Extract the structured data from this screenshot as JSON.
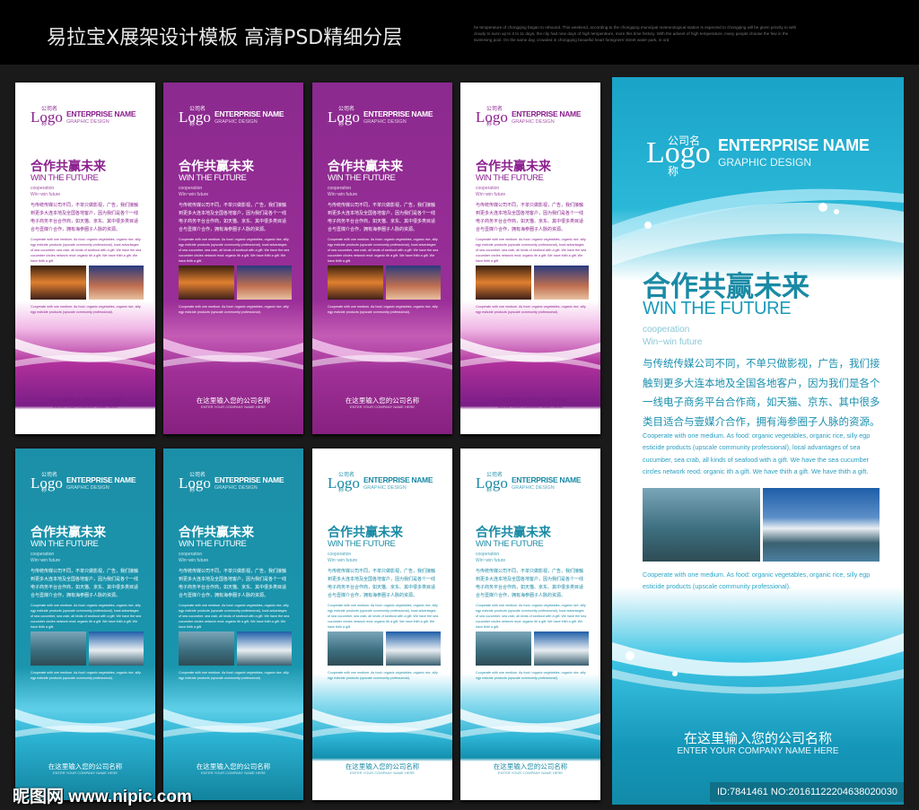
{
  "header": {
    "title": "易拉宝X展架设计模板 高清PSD精细分层",
    "note": "he temperature of chongqing began to rebound. This weekend, according to the chongqing municipal meteorological station is expected to chongqing will be given priority to with cloudy to sunn up to 3 to 11 days, the city had nine days of high temperature, more this time history. With the advent of high temperature, many people choose the few in the swimming pool. On the same day, crowded in chongqing beautiful heart foreigners' street water park, in ord"
  },
  "panel_text": {
    "logo_cn": "公司名称",
    "logo": "Logo",
    "enterprise": "ENTERPRISE NAME",
    "graphic": "GRAPHIC DESIGN",
    "headline": "合作共赢未来",
    "headline_en": "WIN THE FUTURE",
    "coop1": "cooperation",
    "coop2": "Win~win future",
    "body": "与传统传媒公司不同，不单只做影视，广告，我们接触到更多大连本地及全国各地客户，因为我们是各个一线电子商务平台合作商，如天猫、京东、其中很多类目适合与壹媒介合作，拥有海参圈子人脉的资源。",
    "body_en": "Cooperate with one medium. As food: organic vegetables, organic rice, silly egp esticide products (upscale community professional), local advantages of sea cucumber, sea crab, all kinds of seafood with a gift. We have the sea cucumber circles network reod: organic ith a gift. We have thith a gift. We have thith a gift.",
    "caption": "Cooperate with one medium. As food: organic vegetables, organic rice, silly egp esticide products (upscale community professional).",
    "bottom_cn": "在这里输入您的公司名称",
    "bottom_en": "ENTER YOUR COMPANY NAME HERE"
  },
  "panels": [
    {
      "variant": "purple-white"
    },
    {
      "variant": "purple"
    },
    {
      "variant": "purple"
    },
    {
      "variant": "purple-white"
    },
    {
      "variant": "teal"
    },
    {
      "variant": "teal"
    },
    {
      "variant": "teal-white"
    },
    {
      "variant": "teal-white"
    }
  ],
  "colors": {
    "purple": "#8a1f8e",
    "teal": "#1a8aa5"
  },
  "footer": {
    "watermark": "昵图网 www.nipic.com",
    "id": "ID:7841461 NO:20161122204638020030"
  }
}
